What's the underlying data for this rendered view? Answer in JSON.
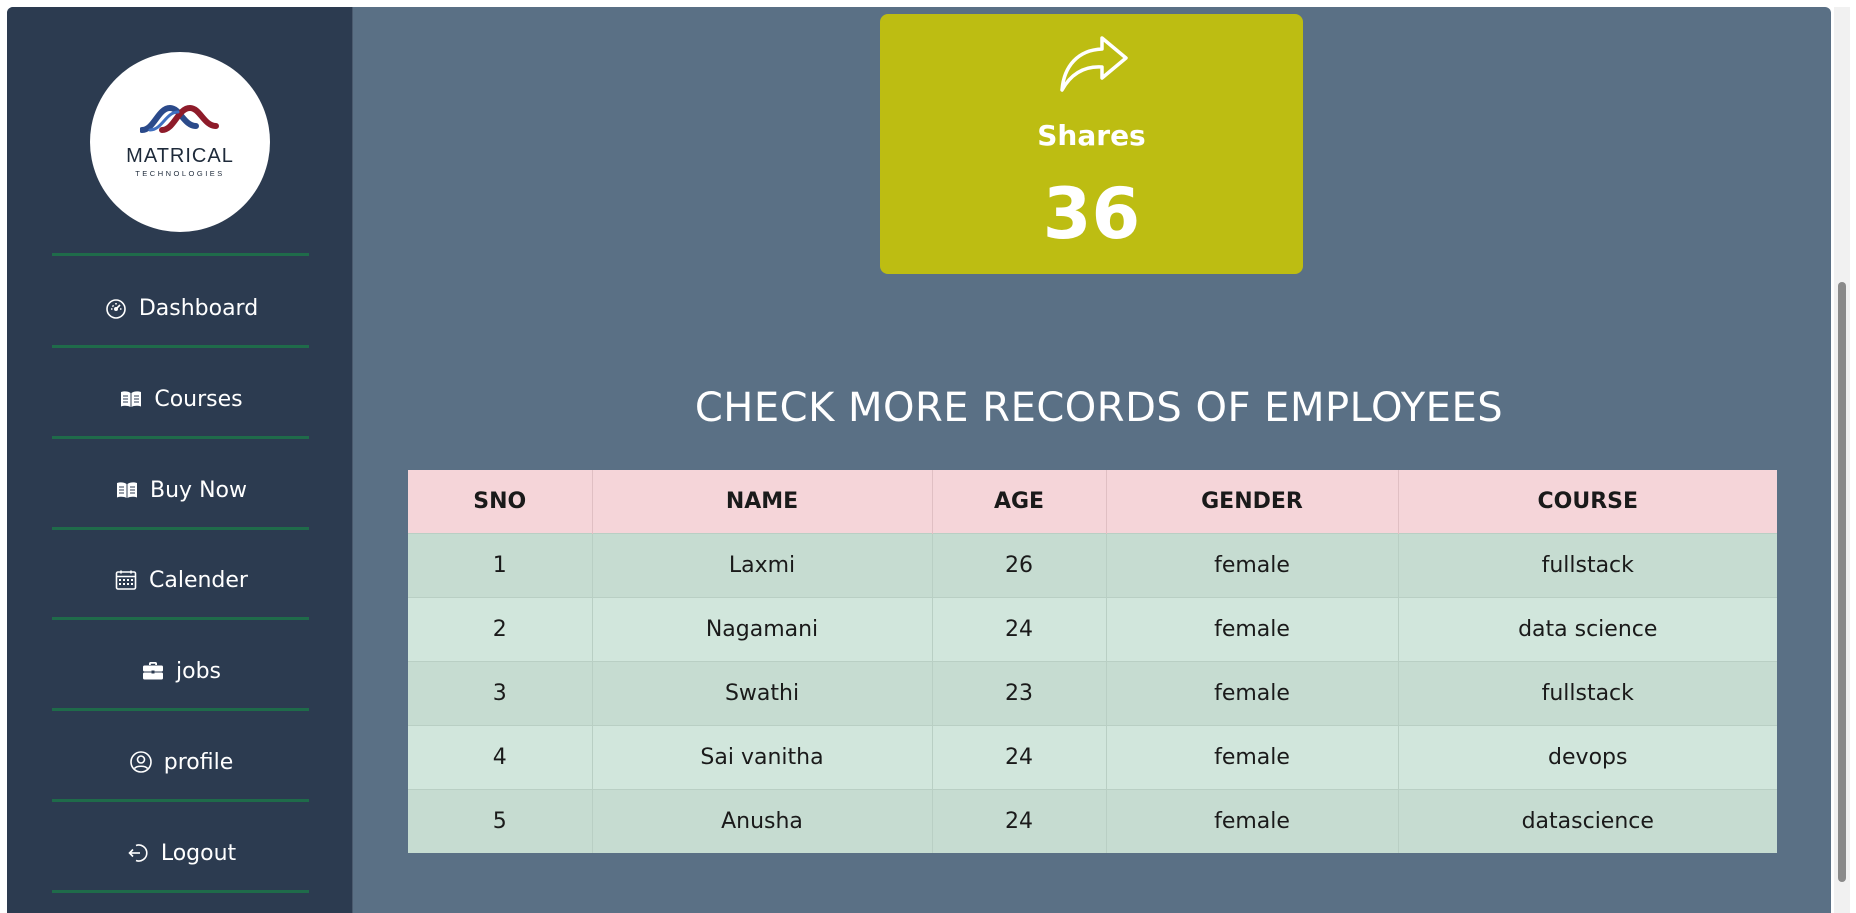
{
  "sidebar": {
    "logo": {
      "name": "MATRICAL",
      "tagline": "TECHNOLOGIES"
    },
    "items": [
      {
        "label": "Dashboard",
        "icon": "speedometer-icon"
      },
      {
        "label": "Courses",
        "icon": "book-icon"
      },
      {
        "label": "Buy Now",
        "icon": "book-icon"
      },
      {
        "label": "Calender",
        "icon": "calendar-icon"
      },
      {
        "label": "jobs",
        "icon": "briefcase-icon"
      },
      {
        "label": "profile",
        "icon": "user-circle-icon"
      },
      {
        "label": "Logout",
        "icon": "logout-icon"
      }
    ]
  },
  "card": {
    "label": "Shares",
    "value": "36",
    "icon": "share-icon",
    "color": "#bdbd12"
  },
  "section": {
    "heading": "CHECK MORE RECORDS OF EMPLOYEES"
  },
  "table": {
    "headers": [
      "SNO",
      "NAME",
      "AGE",
      "GENDER",
      "COURSE"
    ],
    "rows": [
      [
        "1",
        "Laxmi",
        "26",
        "female",
        "fullstack"
      ],
      [
        "2",
        "Nagamani",
        "24",
        "female",
        "data science"
      ],
      [
        "3",
        "Swathi",
        "23",
        "female",
        "fullstack"
      ],
      [
        "4",
        "Sai vanitha",
        "24",
        "female",
        "devops"
      ],
      [
        "5",
        "Anusha",
        "24",
        "female",
        "datascience"
      ]
    ]
  },
  "colors": {
    "sidebar_bg": "#2c3b50",
    "main_bg": "#5a7085",
    "divider": "#1f6b4a",
    "table_header_bg": "#f5d5d9",
    "table_row_bg": "#c6dcd1"
  }
}
